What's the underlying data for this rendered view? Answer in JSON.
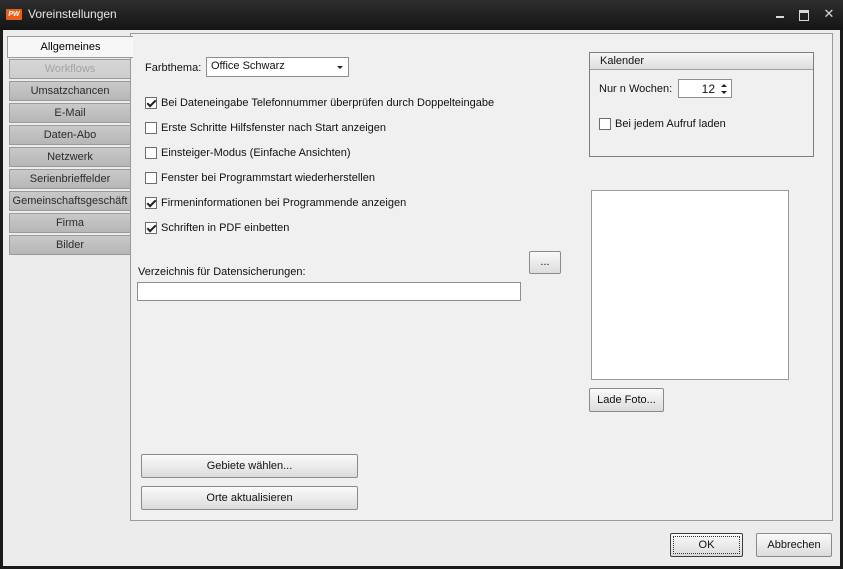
{
  "window": {
    "title": "Voreinstellungen",
    "app_icon_text": "PW"
  },
  "tabs": [
    {
      "label": "Allgemeines",
      "state": "active"
    },
    {
      "label": "Workflows",
      "state": "disabled"
    },
    {
      "label": "Umsatzchancen",
      "state": "normal"
    },
    {
      "label": "E-Mail",
      "state": "normal"
    },
    {
      "label": "Daten-Abo",
      "state": "normal"
    },
    {
      "label": "Netzwerk",
      "state": "normal"
    },
    {
      "label": "Serienbrieffelder",
      "state": "normal"
    },
    {
      "label": "Gemeinschaftsgeschäft",
      "state": "normal"
    },
    {
      "label": "Firma",
      "state": "normal"
    },
    {
      "label": "Bilder",
      "state": "normal"
    }
  ],
  "general": {
    "color_theme_label": "Farbthema:",
    "color_theme_value": "Office Schwarz",
    "checkboxes": [
      {
        "label": "Bei Dateneingabe Telefonnummer überprüfen durch Doppelteingabe",
        "checked": true
      },
      {
        "label": "Erste Schritte Hilfsfenster nach Start anzeigen",
        "checked": false
      },
      {
        "label": "Einsteiger-Modus (Einfache Ansichten)",
        "checked": false
      },
      {
        "label": "Fenster bei Programmstart wiederherstellen",
        "checked": false
      },
      {
        "label": "Firmeninformationen bei Programmende anzeigen",
        "checked": true
      },
      {
        "label": "Schriften in PDF einbetten",
        "checked": true
      }
    ],
    "backup_dir_label": "Verzeichnis für Datensicherungen:",
    "backup_dir_value": "",
    "browse_label": "...",
    "select_areas_label": "Gebiete wählen...",
    "update_places_label": "Orte aktualisieren"
  },
  "calendar": {
    "title": "Kalender",
    "weeks_label": "Nur n Wochen:",
    "weeks_value": "12",
    "reload_label": "Bei jedem Aufruf laden",
    "reload_checked": false
  },
  "photo": {
    "load_label": "Lade Foto..."
  },
  "footer": {
    "ok_label": "OK",
    "cancel_label": "Abbrechen"
  },
  "colors": {
    "titlebar": "#1b1b1b",
    "panel": "#f0f0f0",
    "app_icon": "#e8601a"
  }
}
